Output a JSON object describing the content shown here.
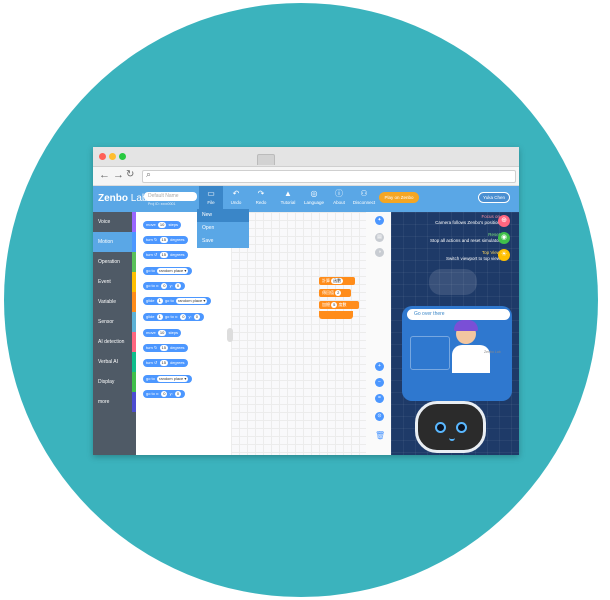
{
  "browser": {
    "url": ""
  },
  "header": {
    "logo_main": "Zenbo",
    "logo_sub": "Lab",
    "project_placeholder": "Default Name",
    "project_id": "Proj ID: xxxx0001",
    "tools": [
      {
        "label": "File",
        "icon": "folder-icon"
      },
      {
        "label": "Undo",
        "icon": "undo-icon"
      },
      {
        "label": "Redo",
        "icon": "redo-icon"
      },
      {
        "label": "Tutorial",
        "icon": "graduation-cap-icon"
      },
      {
        "label": "Language",
        "icon": "globe-icon"
      },
      {
        "label": "About",
        "icon": "info-icon"
      },
      {
        "label": "Disconnect",
        "icon": "disconnect-icon"
      }
    ],
    "play_label": "Play on Zenbo",
    "user_label": "Yuka Chen"
  },
  "file_menu": {
    "items": [
      "New",
      "Open",
      "Save"
    ]
  },
  "categories": [
    {
      "label": "Voice",
      "color": "#9966ff"
    },
    {
      "label": "Motion",
      "color": "#4c97ff"
    },
    {
      "label": "Operation",
      "color": "#59c059"
    },
    {
      "label": "Event",
      "color": "#ffbf00"
    },
    {
      "label": "Variable",
      "color": "#ff8c1a"
    },
    {
      "label": "Sensor",
      "color": "#5cb1d6"
    },
    {
      "label": "AI detection",
      "color": "#ff6680"
    },
    {
      "label": "Verbal AI",
      "color": "#0fbd8c"
    },
    {
      "label": "Display",
      "color": "#40bf4a"
    },
    {
      "label": "more",
      "color": "#4c4cd1"
    }
  ],
  "palette": {
    "blocks": [
      {
        "parts": [
          "move",
          "10",
          "steps"
        ]
      },
      {
        "parts": [
          "turn",
          "↻",
          "15",
          "degrees"
        ]
      },
      {
        "parts": [
          "turn",
          "↺",
          "15",
          "degrees"
        ]
      },
      {
        "parts": [
          "go to",
          "random place ▾"
        ]
      },
      {
        "parts": [
          "go to x:",
          "0",
          "y:",
          "0"
        ]
      },
      {
        "parts": [
          "glide",
          "1",
          "go to",
          "random place ▾"
        ]
      },
      {
        "parts": [
          "glide",
          "1",
          "go to x:",
          "0",
          "y:",
          "0"
        ]
      },
      {
        "parts": [
          "move",
          "10",
          "steps"
        ]
      },
      {
        "parts": [
          "turn",
          "↻",
          "15",
          "degrees"
        ]
      },
      {
        "parts": [
          "turn",
          "↺",
          "15",
          "degrees"
        ]
      },
      {
        "parts": [
          "go to",
          "random place ▾"
        ]
      },
      {
        "parts": [
          "go to x:",
          "0",
          "y:",
          "0"
        ]
      }
    ]
  },
  "workspace": {
    "script": [
      {
        "parts": [
          "計算",
          "函數"
        ]
      },
      {
        "parts": [
          "傳回值",
          "2"
        ]
      },
      {
        "parts": [
          "加總",
          "5",
          "度數"
        ]
      }
    ]
  },
  "simulator": {
    "tips": [
      {
        "title": "Focus on",
        "text": "Camera follows Zenbo's position",
        "icon": "focus-icon",
        "color": "#ff6680"
      },
      {
        "title": "Reset",
        "text": "Stop all actions and reset simulator",
        "icon": "reset-icon",
        "color": "#40bf4a"
      },
      {
        "title": "Top View",
        "text": "Switch viewport to top view",
        "icon": "top-view-icon",
        "color": "#ffbf00"
      }
    ],
    "speech": "Go over there",
    "card_label": "Zenbo Lab"
  }
}
